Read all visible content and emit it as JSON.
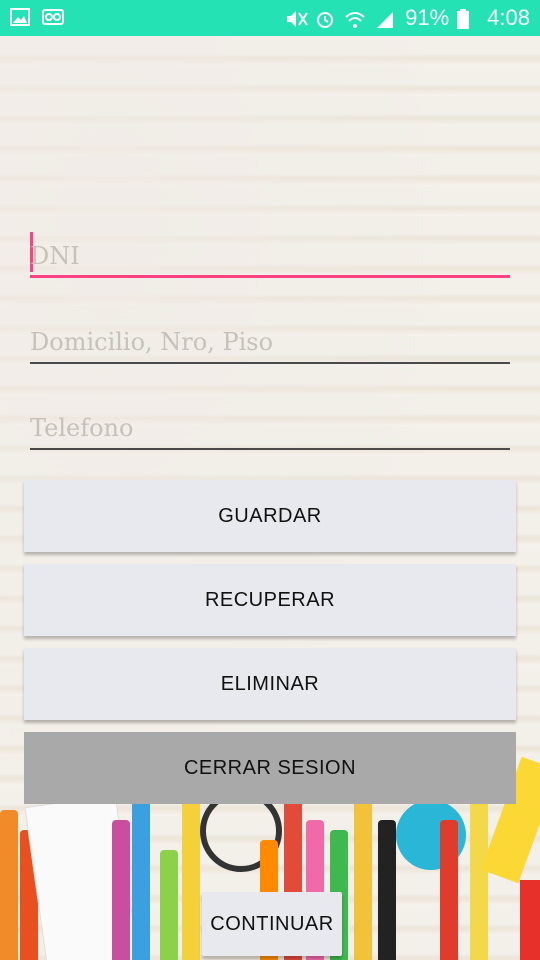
{
  "status_bar": {
    "battery": "91%",
    "time": "4:08",
    "icons": [
      "image-icon",
      "voicemail-icon",
      "mute-icon",
      "alarm-icon",
      "wifi-icon",
      "signal-icon",
      "battery-icon"
    ]
  },
  "form": {
    "dni_placeholder": "DNI",
    "domicilio_placeholder": "Domicilio, Nro, Piso",
    "telefono_placeholder": "Telefono"
  },
  "buttons": {
    "guardar": "GUARDAR",
    "recuperar": "RECUPERAR",
    "eliminar": "ELIMINAR",
    "cerrar_sesion": "CERRAR SESION",
    "continuar": "CONTINUAR"
  },
  "colors": {
    "status_bar": "#25e2b4",
    "accent": "#ff4081",
    "button_bg": "#e8e9ee",
    "button_dark": "#a9a9a9"
  }
}
